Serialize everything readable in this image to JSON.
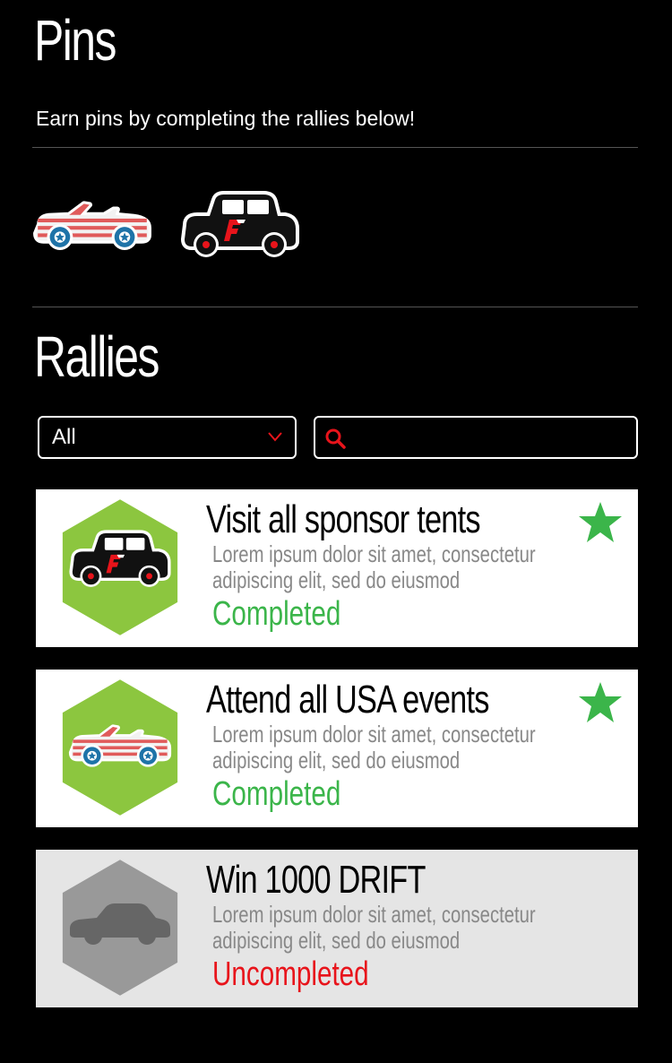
{
  "pins": {
    "title": "Pins",
    "subtitle": "Earn pins by completing the rallies below!",
    "earned": [
      "striped-convertible-icon",
      "black-jeep-icon"
    ]
  },
  "rallies": {
    "title": "Rallies",
    "filter": {
      "selected": "All"
    },
    "search": {
      "placeholder": ""
    },
    "items": [
      {
        "title": "Visit all sponsor tents",
        "description": "Lorem ipsum dolor sit amet, consectetur adipiscing elit, sed do eiusmod",
        "status": "Completed",
        "icon": "black-jeep-icon",
        "starred": true
      },
      {
        "title": "Attend all USA events",
        "description": "Lorem ipsum dolor sit amet, consectetur adipiscing elit, sed do eiusmod",
        "status": "Completed",
        "icon": "striped-convertible-icon",
        "starred": true
      },
      {
        "title": "Win 1000 DRIFT",
        "description": "Lorem ipsum dolor sit amet, consectetur adipiscing elit, sed do eiusmod",
        "status": "Uncompleted",
        "icon": "gray-sedan-silhouette-icon",
        "starred": false
      }
    ]
  },
  "colors": {
    "completed": "#3bb54a",
    "uncompleted": "#e8141b",
    "hex_active": "#8cc63f",
    "hex_locked": "#999999",
    "star": "#3bb54a",
    "accent_red": "#e8141b"
  }
}
